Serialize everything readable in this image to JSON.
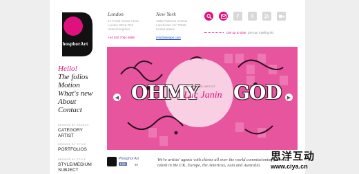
{
  "logo": {
    "text": "PhosphorArt"
  },
  "offices": [
    {
      "city": "London",
      "lines": [
        "41 Portal House Close",
        "London SE16 7HS",
        "United Kingdom"
      ],
      "phone": "+44 020 7064 4666"
    },
    {
      "city": "New York",
      "lines": [
        "1935 Paterson Avenue",
        "Lanchester NY 70026",
        "United States"
      ],
      "email": "info@siteaps.com"
    }
  ],
  "social": [
    "search-icon",
    "email-icon",
    "facebook-icon",
    "twitter-icon",
    "rss-icon",
    "video-icon"
  ],
  "mailing": {
    "highlight": "Get up to date,",
    "rest": " join our mailing list"
  },
  "nav": [
    "Hello!",
    "The folios",
    "Motion",
    "What's new",
    "About",
    "Contact"
  ],
  "side": {
    "group1": "BROWSE BY SEARCH",
    "links1": [
      "CATEGORY",
      "ARTIST"
    ],
    "group2": "BROWSE BY STYLE",
    "links2": [
      "PORTFOLIOS"
    ],
    "group3": "BROWSE BY STYLE",
    "links3": [
      "STYLE/MEDIUM",
      "SUBJECT"
    ]
  },
  "banner": {
    "word1": "OHMY",
    "word2": "GOD",
    "featured_label": "FEATURED ARTIST",
    "artist_name": "Luc Janin",
    "accent": "#e0117f"
  },
  "facebook": {
    "name": "Phosphor Art",
    "like": "Like",
    "count": "40"
  },
  "tagline": "We're artists' agents with clients all over the world commissioning from our talent in the UK, Europe, the Americas, Asia and Australia.",
  "watermark": {
    "line1": "思洋互动",
    "line2": "www.ciya.cn"
  }
}
